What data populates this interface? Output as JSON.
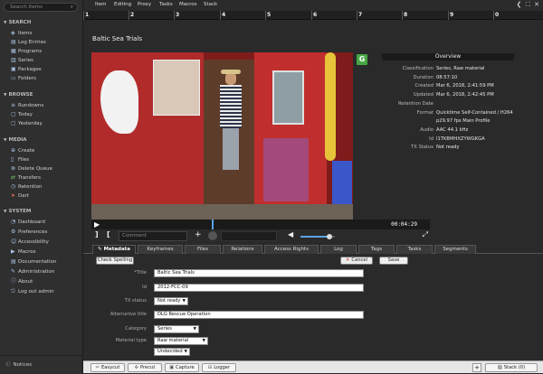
{
  "sidebar": {
    "search_placeholder": "Search items",
    "sections": [
      {
        "title": "SEARCH",
        "items": [
          {
            "label": "Items",
            "icon": "tag-icon"
          },
          {
            "label": "Log Entries",
            "icon": "log-icon"
          },
          {
            "label": "Programs",
            "icon": "program-icon"
          },
          {
            "label": "Series",
            "icon": "series-icon"
          },
          {
            "label": "Packages",
            "icon": "package-icon"
          },
          {
            "label": "Folders",
            "icon": "folder-icon"
          }
        ]
      },
      {
        "title": "BROWSE",
        "items": [
          {
            "label": "Rundowns",
            "icon": "rundown-icon"
          },
          {
            "label": "Today",
            "icon": "calendar-icon"
          },
          {
            "label": "Yesterday",
            "icon": "calendar-icon"
          }
        ]
      },
      {
        "title": "MEDIA",
        "items": [
          {
            "label": "Create",
            "icon": "create-icon"
          },
          {
            "label": "Files",
            "icon": "file-icon"
          },
          {
            "label": "Delete Queue",
            "icon": "delete-icon"
          },
          {
            "label": "Transfers",
            "icon": "transfer-icon"
          },
          {
            "label": "Retention",
            "icon": "retention-icon"
          },
          {
            "label": "Dart",
            "icon": "dart-icon"
          }
        ]
      },
      {
        "title": "SYSTEM",
        "items": [
          {
            "label": "Dashboard",
            "icon": "dashboard-icon"
          },
          {
            "label": "Preferences",
            "icon": "preferences-icon"
          },
          {
            "label": "Accessibility",
            "icon": "accessibility-icon"
          },
          {
            "label": "Macros",
            "icon": "macro-icon"
          },
          {
            "label": "Documentation",
            "icon": "doc-icon"
          },
          {
            "label": "Administration",
            "icon": "admin-icon"
          },
          {
            "label": "About",
            "icon": "info-icon"
          },
          {
            "label": "Log out admin",
            "icon": "logout-icon"
          }
        ]
      }
    ],
    "notices": "Notices"
  },
  "menu": [
    "Item",
    "Editing",
    "Proxy",
    "Tasks",
    "Macros",
    "Stack"
  ],
  "numbers": [
    "1",
    "2",
    "3",
    "4",
    "5",
    "6",
    "7",
    "8",
    "9",
    "0"
  ],
  "item_title": "Baltic Sea Trials",
  "player": {
    "timecode": "00:04:29",
    "comment_placeholder": "Comment",
    "progress": 0.38,
    "volume": 0.85
  },
  "overview": {
    "header": "Overview",
    "rows": [
      {
        "k": "Classification",
        "v": "Series, Raw material"
      },
      {
        "k": "Duration",
        "v": "08:57:10"
      },
      {
        "k": "Created",
        "v": "Mar 6, 2018, 2:41:59 PM"
      },
      {
        "k": "Updated",
        "v": "Mar 6, 2018, 2:42:45 PM"
      },
      {
        "k": "Retention Date",
        "v": ""
      },
      {
        "k": "Format",
        "v": "Quicktime Self-Contained / H264"
      },
      {
        "k": "",
        "v": "p29.97 fps Main Profile"
      },
      {
        "k": "Audio",
        "v": "AAC 44.1 kHz"
      },
      {
        "k": "Id",
        "v": "I1TKBMHXZYWGKGA"
      },
      {
        "k": "TX Status",
        "v": "Not ready"
      }
    ]
  },
  "tabs": [
    "Metadata",
    "Keyframes",
    "Files",
    "Relations",
    "Access Rights",
    "Log",
    "Tags",
    "Tasks",
    "Segments"
  ],
  "form": {
    "check_spelling": "Check Spelling",
    "cancel": "Cancel",
    "save": "Save",
    "fields": [
      {
        "label": "*Title",
        "value": "Baltic Sea Trials",
        "type": "text"
      },
      {
        "label": "Id",
        "value": "2012-FCC-09",
        "type": "text"
      },
      {
        "label": "TX status",
        "value": "Not ready",
        "type": "select"
      },
      {
        "label": "Alternative title",
        "value": "DLG Rescue Operation",
        "type": "text"
      },
      {
        "label": "Category",
        "value": "Series",
        "type": "select"
      },
      {
        "label": "Material type",
        "value": "Raw material",
        "type": "select"
      },
      {
        "label": "",
        "value": "Undecided",
        "type": "select"
      }
    ]
  },
  "bottombar": {
    "buttons": [
      {
        "label": "Easycut",
        "icon": "scissors-icon"
      },
      {
        "label": "Precut",
        "icon": "precut-icon"
      },
      {
        "label": "Capture",
        "icon": "capture-icon"
      },
      {
        "label": "Logger",
        "icon": "logger-icon"
      }
    ],
    "stack": "Stack (0)"
  }
}
